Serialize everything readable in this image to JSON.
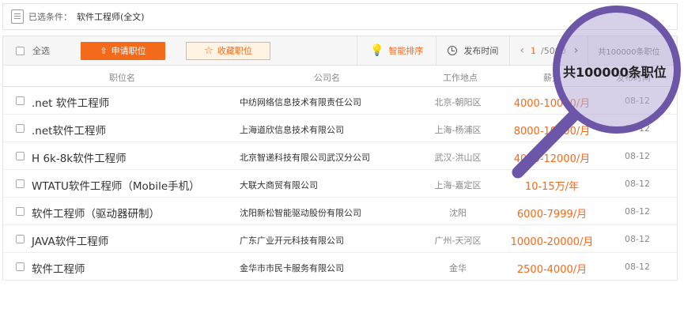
{
  "filter": {
    "label": "已选条件：",
    "value": "软件工程师(全文)"
  },
  "toolbar": {
    "select_all": "全选",
    "apply_label": "申请职位",
    "favorite_label": "收藏职位",
    "smart_sort_label": "智能排序",
    "publish_time_label": "发布时间",
    "page_current": "1",
    "page_total": "/5000",
    "total_text": "共100000条职位"
  },
  "columns": {
    "title": "职位名",
    "company": "公司名",
    "location": "工作地点",
    "salary": "薪资",
    "date": "发布时间"
  },
  "jobs": [
    {
      "title": ".net 软件工程师",
      "company": "中纺网络信息技术有限责任公司",
      "location": "北京-朝阳区",
      "salary": "4000-10000/月",
      "date": "08-12"
    },
    {
      "title": ".net软件工程师",
      "company": "上海道欣信息技术有限公司",
      "location": "上海-杨浦区",
      "salary": "8000-10000/月",
      "date": "08-12"
    },
    {
      "title": "H 6k-8k软件工程师",
      "company": "北京智递科技有限公司武汉分公司",
      "location": "武汉-洪山区",
      "salary": "4000-12000/月",
      "date": "08-12"
    },
    {
      "title": "WTATU软件工程师（Mobile手机）",
      "company": "大联大商贸有限公司",
      "location": "上海-嘉定区",
      "salary": "10-15万/年",
      "date": "08-12"
    },
    {
      "title": "软件工程师（驱动器研制）",
      "company": "沈阳新松智能驱动股份有限公司",
      "location": "沈阳",
      "salary": "6000-7999/月",
      "date": "08-12"
    },
    {
      "title": "JAVA软件工程师",
      "company": "广东广业开元科技有限公司",
      "location": "广州-天河区",
      "salary": "10000-20000/月",
      "date": "08-12"
    },
    {
      "title": "软件工程师",
      "company": "金华市市民卡服务有限公司",
      "location": "金华",
      "salary": "2500-4000/月",
      "date": "08-12"
    }
  ],
  "magnifier": {
    "text": "共100000条职位"
  },
  "colors": {
    "accent": "#f36a1b",
    "magnifier": "#6d56a8"
  },
  "icons": [
    "filter-icon",
    "upload-icon",
    "star-icon",
    "bulb-icon",
    "clock-icon",
    "chevron-left-icon",
    "chevron-right-icon",
    "magnifier-icon"
  ]
}
